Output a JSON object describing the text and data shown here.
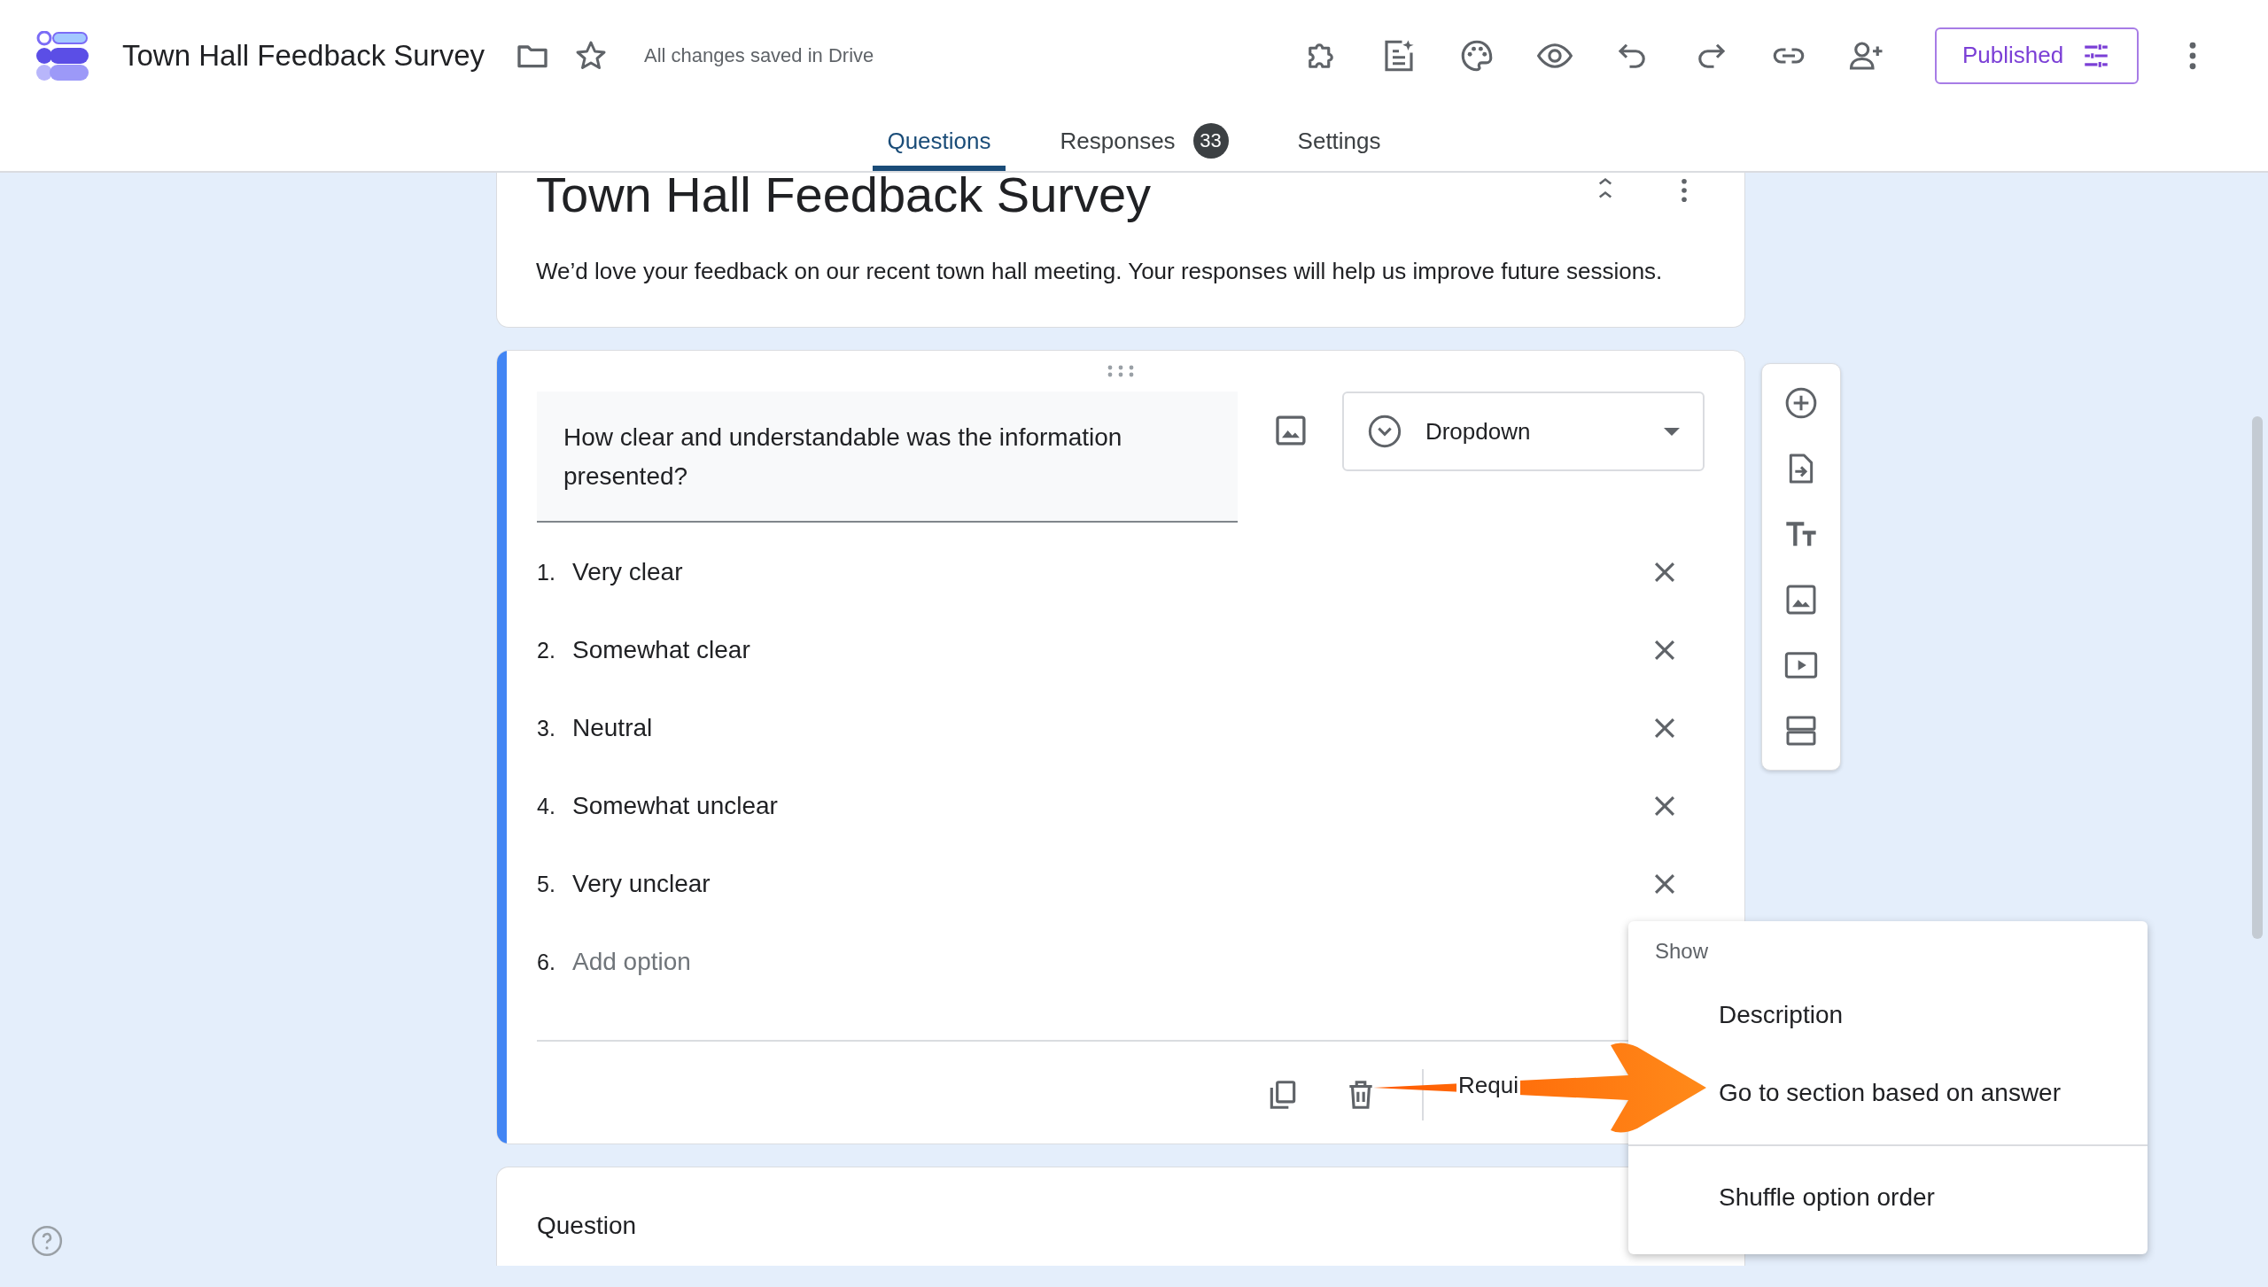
{
  "app": {
    "title": "Town Hall Feedback Survey",
    "save_status": "All changes saved in Drive",
    "publish_button": "Published"
  },
  "tabs": [
    {
      "label": "Questions",
      "selected": true
    },
    {
      "label": "Responses",
      "selected": false,
      "badge": "33"
    },
    {
      "label": "Settings",
      "selected": false
    }
  ],
  "form_header": {
    "title": "Town Hall Feedback Survey",
    "description": "We’d love your feedback on our recent town hall meeting. Your responses will help us improve future sessions."
  },
  "question": {
    "title": "How clear and understandable was the information presented?",
    "type": "Dropdown",
    "options": [
      {
        "number": "1.",
        "label": "Very clear"
      },
      {
        "number": "2.",
        "label": "Somewhat clear"
      },
      {
        "number": "3.",
        "label": "Neutral"
      },
      {
        "number": "4.",
        "label": "Somewhat unclear"
      },
      {
        "number": "5.",
        "label": "Very unclear"
      }
    ],
    "add_option": {
      "number": "6.",
      "placeholder": "Add option"
    },
    "required_label": "Requi"
  },
  "next_question": {
    "placeholder": "Question"
  },
  "menu": {
    "heading": "Show",
    "items": [
      {
        "label": "Description"
      },
      {
        "label": "Go to section based on answer"
      },
      {
        "label": "Shuffle option order"
      }
    ]
  }
}
